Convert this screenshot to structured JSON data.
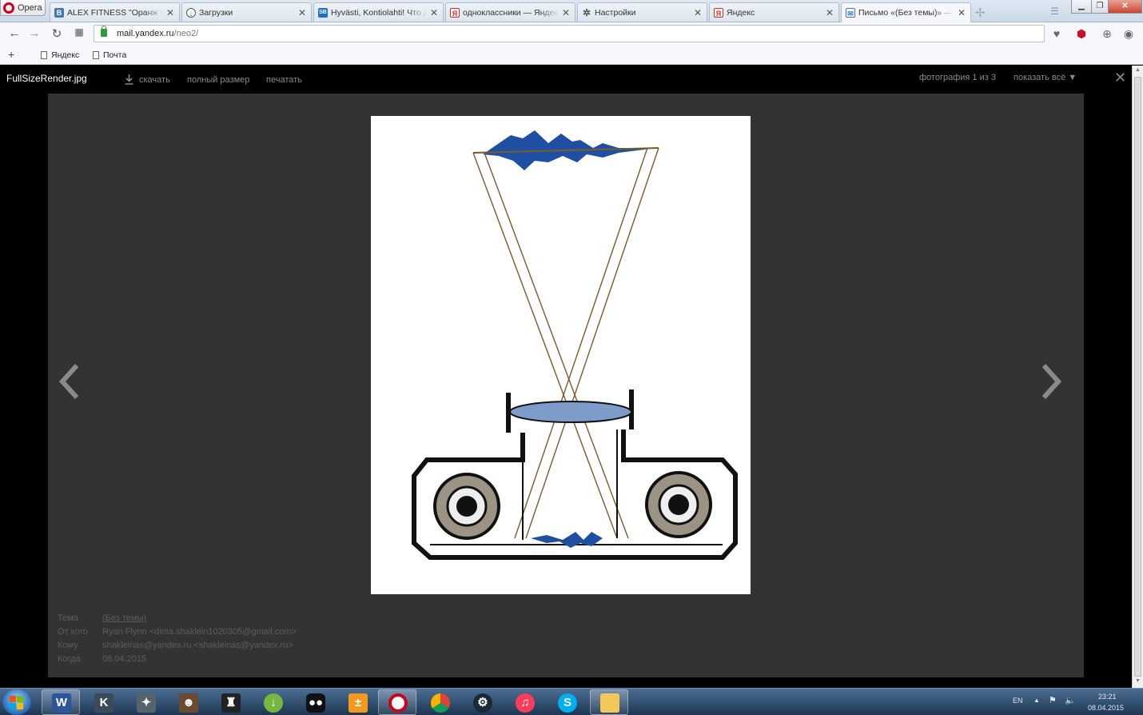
{
  "browser": {
    "menu_label": "Opera",
    "tabs": [
      {
        "label": "ALEX FITNESS \"Оранж Ме",
        "favicon": "vk-icon",
        "color": "#4a76a8",
        "glyph": "B"
      },
      {
        "label": "Загрузки",
        "favicon": "download-icon",
        "color": "#555555",
        "glyph": "↓"
      },
      {
        "label": "Hyvästi, Kontiolahti! Что д",
        "favicon": "sportbox-icon",
        "color": "#1f6fc2",
        "glyph": "SB"
      },
      {
        "label": "одноклассники — Яндек",
        "favicon": "yandex-icon",
        "color": "#e52620",
        "glyph": "Я"
      },
      {
        "label": "Настройки",
        "favicon": "gear-icon",
        "color": "#666666",
        "glyph": "✲"
      },
      {
        "label": "Яндекс",
        "favicon": "yandex-icon",
        "color": "#e52620",
        "glyph": "Я"
      },
      {
        "label": "Письмо «(Без темы)» — Я",
        "favicon": "mail-icon",
        "color": "#3b78c3",
        "glyph": "✉"
      }
    ],
    "address": {
      "host": "mail.yandex.ru",
      "path": "/neo2/"
    },
    "bookmarks": [
      "Яндекс",
      "Почта"
    ]
  },
  "viewer": {
    "filename": "FullSizeRender.jpg",
    "actions": {
      "download": "скачать",
      "full_size": "полный размер",
      "print": "печатать"
    },
    "photo_count": "фотография 1 из 3",
    "show_all": "показать всё ▼",
    "meta": {
      "subject_label": "Тема",
      "subject": "(Без темы)",
      "from_label": "От кого",
      "from": "Ryan Flynn <dima.shaklein1020305@gmail.com>",
      "to_label": "Кому",
      "to": "shakleinas@yandex.ru <shakleinas@yandex.ru>",
      "date_label": "Когда",
      "date": "08.04.2015"
    }
  },
  "taskbar": {
    "lang": "EN",
    "time": "23:21",
    "date": "08.04.2015"
  },
  "colors": {
    "stage_bg": "#333333",
    "meta_text": "#5c5c5c",
    "drawing_line": "#7a5a2a",
    "flame_blue": "#1e4fa3"
  }
}
